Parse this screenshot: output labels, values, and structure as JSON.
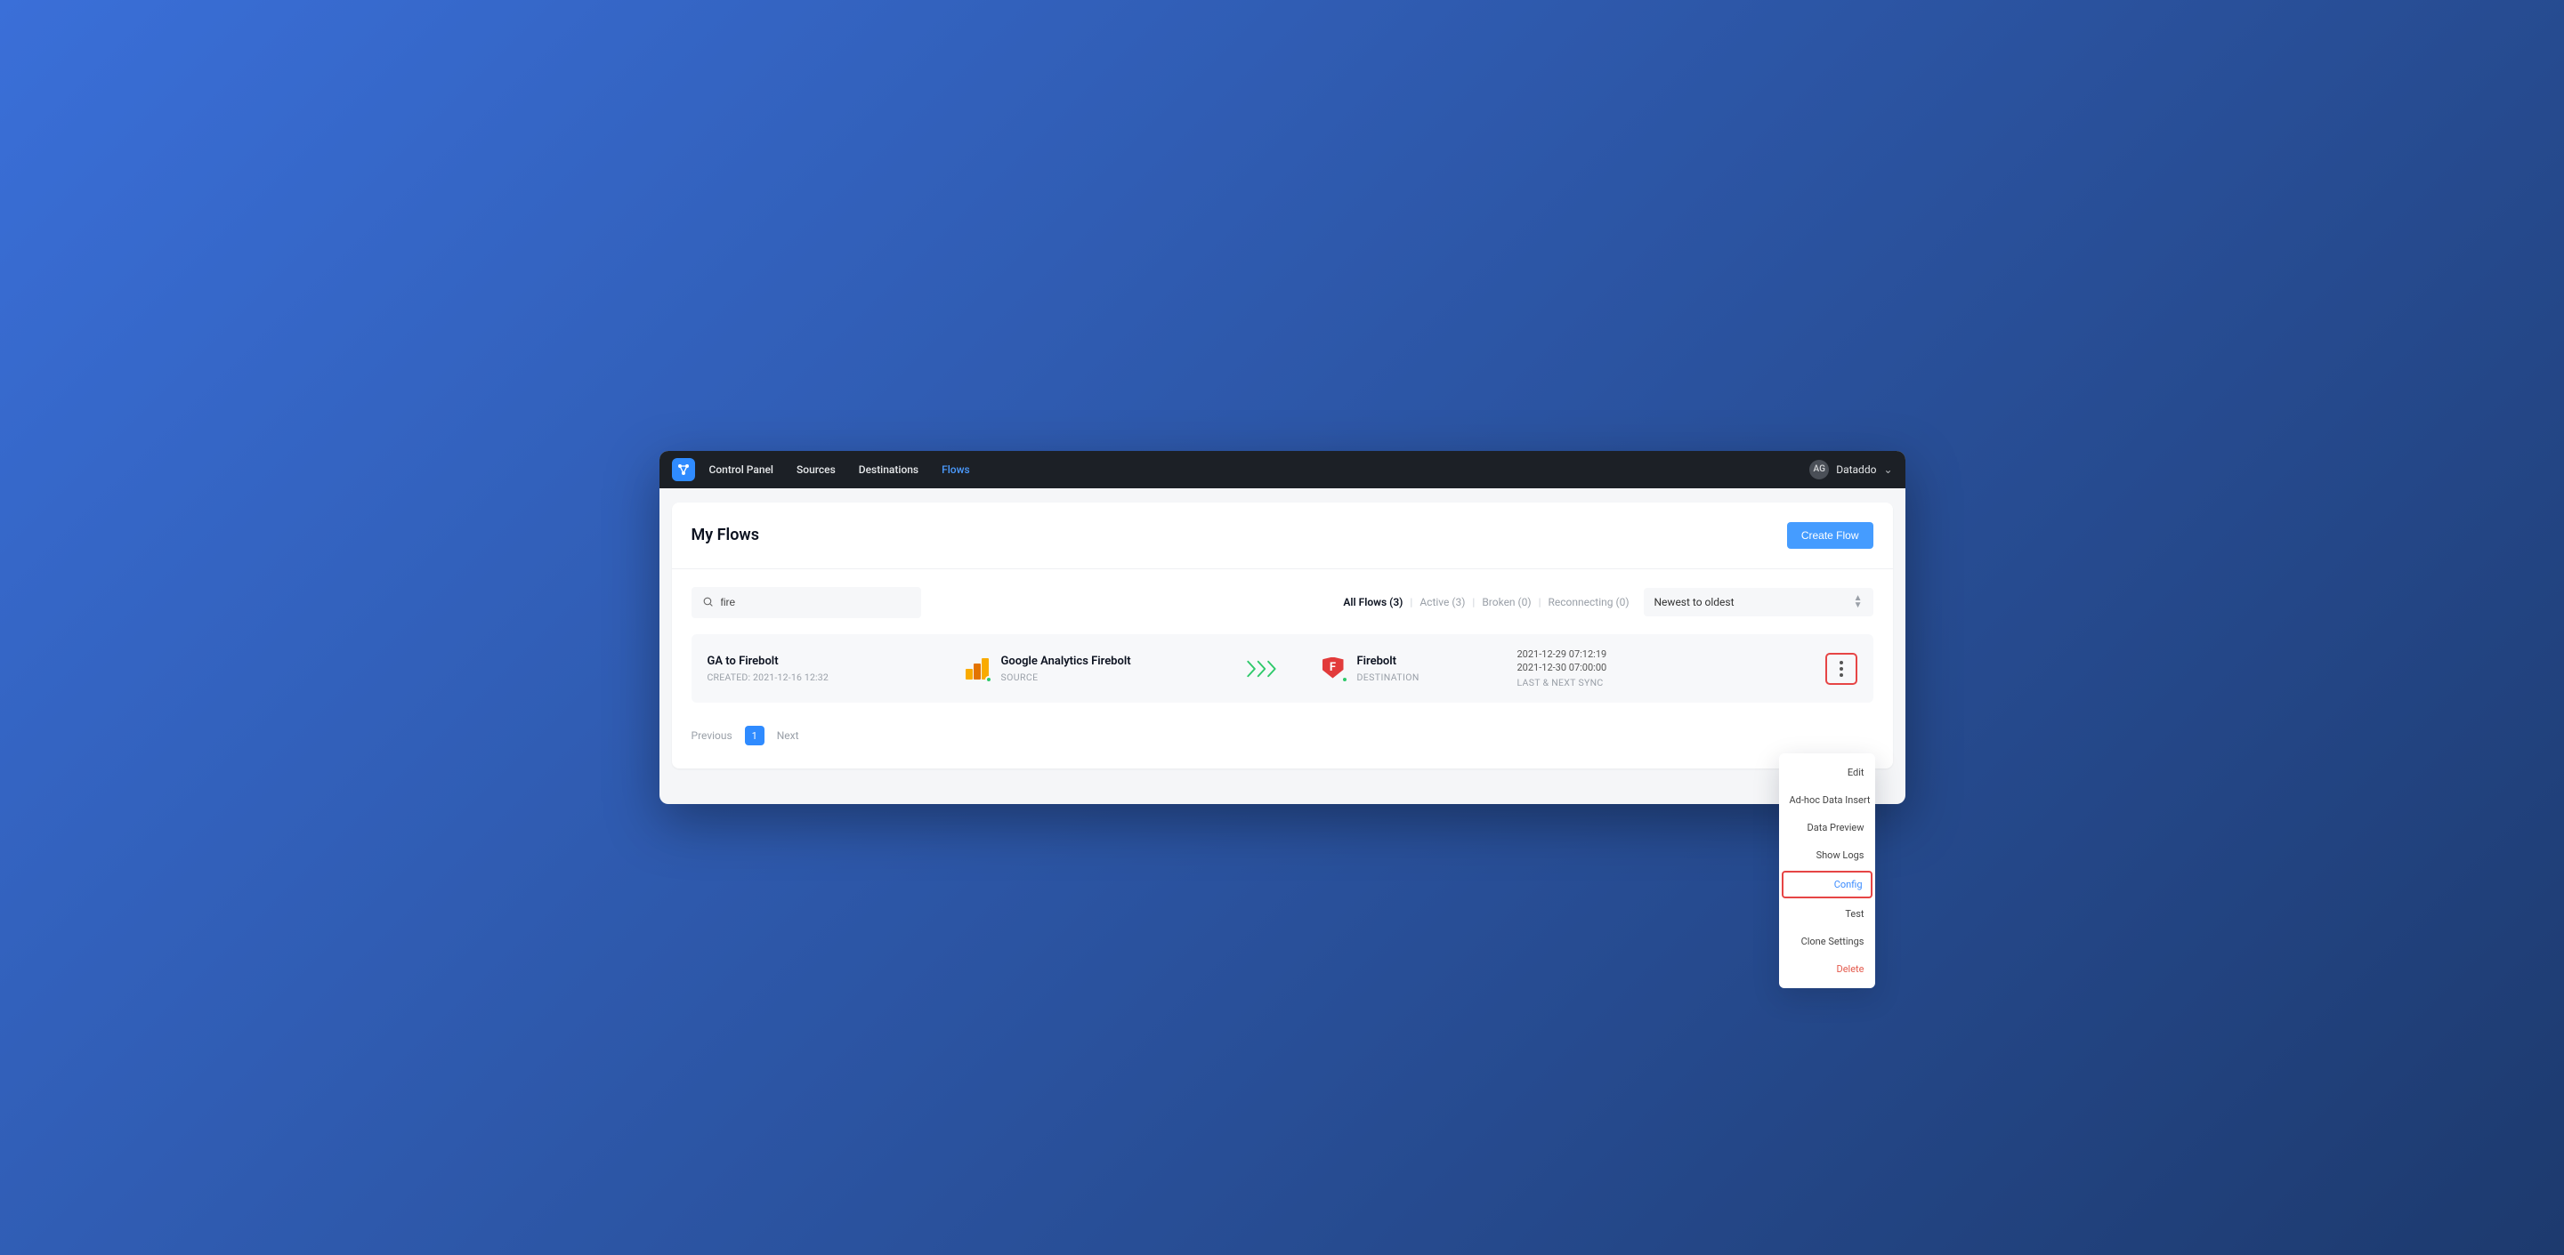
{
  "nav": {
    "links": [
      "Control Panel",
      "Sources",
      "Destinations",
      "Flows"
    ],
    "activeIndex": 3,
    "user": {
      "initials": "AG",
      "name": "Dataddo"
    }
  },
  "header": {
    "title": "My Flows",
    "createButton": "Create Flow"
  },
  "search": {
    "value": "fire"
  },
  "statusFilters": {
    "items": [
      {
        "label": "All Flows (3)",
        "active": true
      },
      {
        "label": "Active (3)",
        "active": false
      },
      {
        "label": "Broken (0)",
        "active": false
      },
      {
        "label": "Reconnecting (0)",
        "active": false
      }
    ]
  },
  "sort": {
    "selected": "Newest to oldest"
  },
  "flow": {
    "name": "GA to Firebolt",
    "createdLabel": "CREATED: 2021-12-16 12:32",
    "source": {
      "name": "Google Analytics Firebolt",
      "sub": "SOURCE"
    },
    "destination": {
      "name": "Firebolt",
      "sub": "DESTINATION"
    },
    "sync": {
      "last": "2021-12-29 07:12:19",
      "next": "2021-12-30 07:00:00",
      "sub": "LAST & NEXT SYNC"
    }
  },
  "pagination": {
    "previous": "Previous",
    "page": "1",
    "next": "Next"
  },
  "menu": {
    "edit": "Edit",
    "adhoc": "Ad-hoc Data Insert",
    "preview": "Data Preview",
    "logs": "Show Logs",
    "config": "Config",
    "test": "Test",
    "clone": "Clone Settings",
    "delete": "Delete"
  }
}
